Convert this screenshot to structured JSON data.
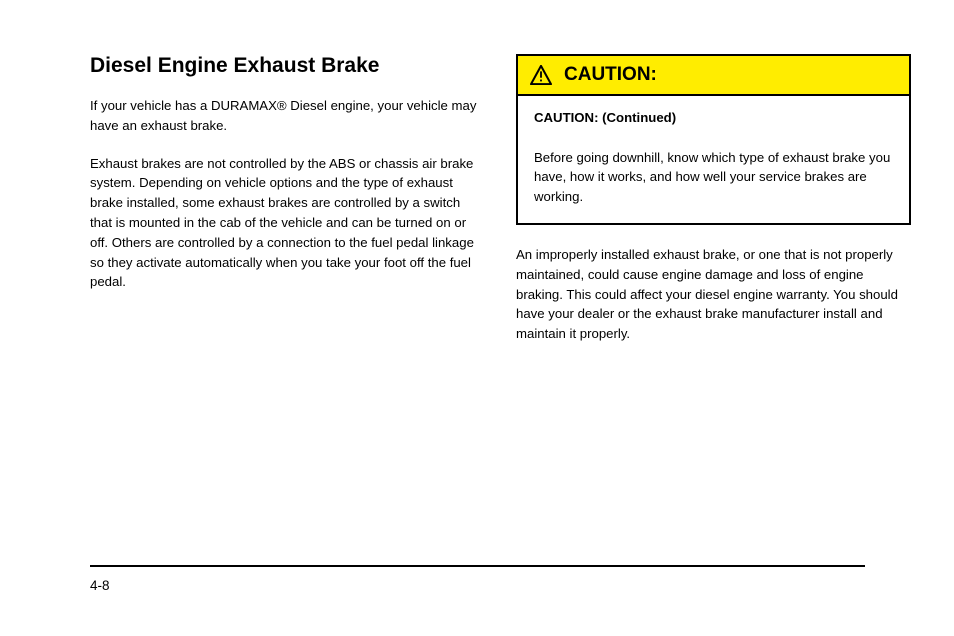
{
  "left": {
    "heading": "Diesel Engine Exhaust Brake",
    "para1": "If your vehicle has a DURAMAX® Diesel engine, your vehicle may have an exhaust brake.",
    "para2": "Exhaust brakes are not controlled by the ABS or chassis air brake system. Depending on vehicle options and the type of exhaust brake installed, some exhaust brakes are controlled by a switch that is mounted in the cab of the vehicle and can be turned on or off. Others are controlled by a connection to the fuel pedal linkage so they activate automatically when you take your foot off the fuel pedal."
  },
  "caution": {
    "label": "CAUTION:",
    "lead": "CAUTION: (Continued)",
    "body": "Before going downhill, know which type of exhaust brake you have, how it works, and how well your service brakes are working."
  },
  "right": {
    "para": "An improperly installed exhaust brake, or one that is not properly maintained, could cause engine damage and loss of engine braking. This could affect your diesel engine warranty. You should have your dealer or the exhaust brake manufacturer install and maintain it properly."
  },
  "footer": {
    "page": "4-8"
  }
}
